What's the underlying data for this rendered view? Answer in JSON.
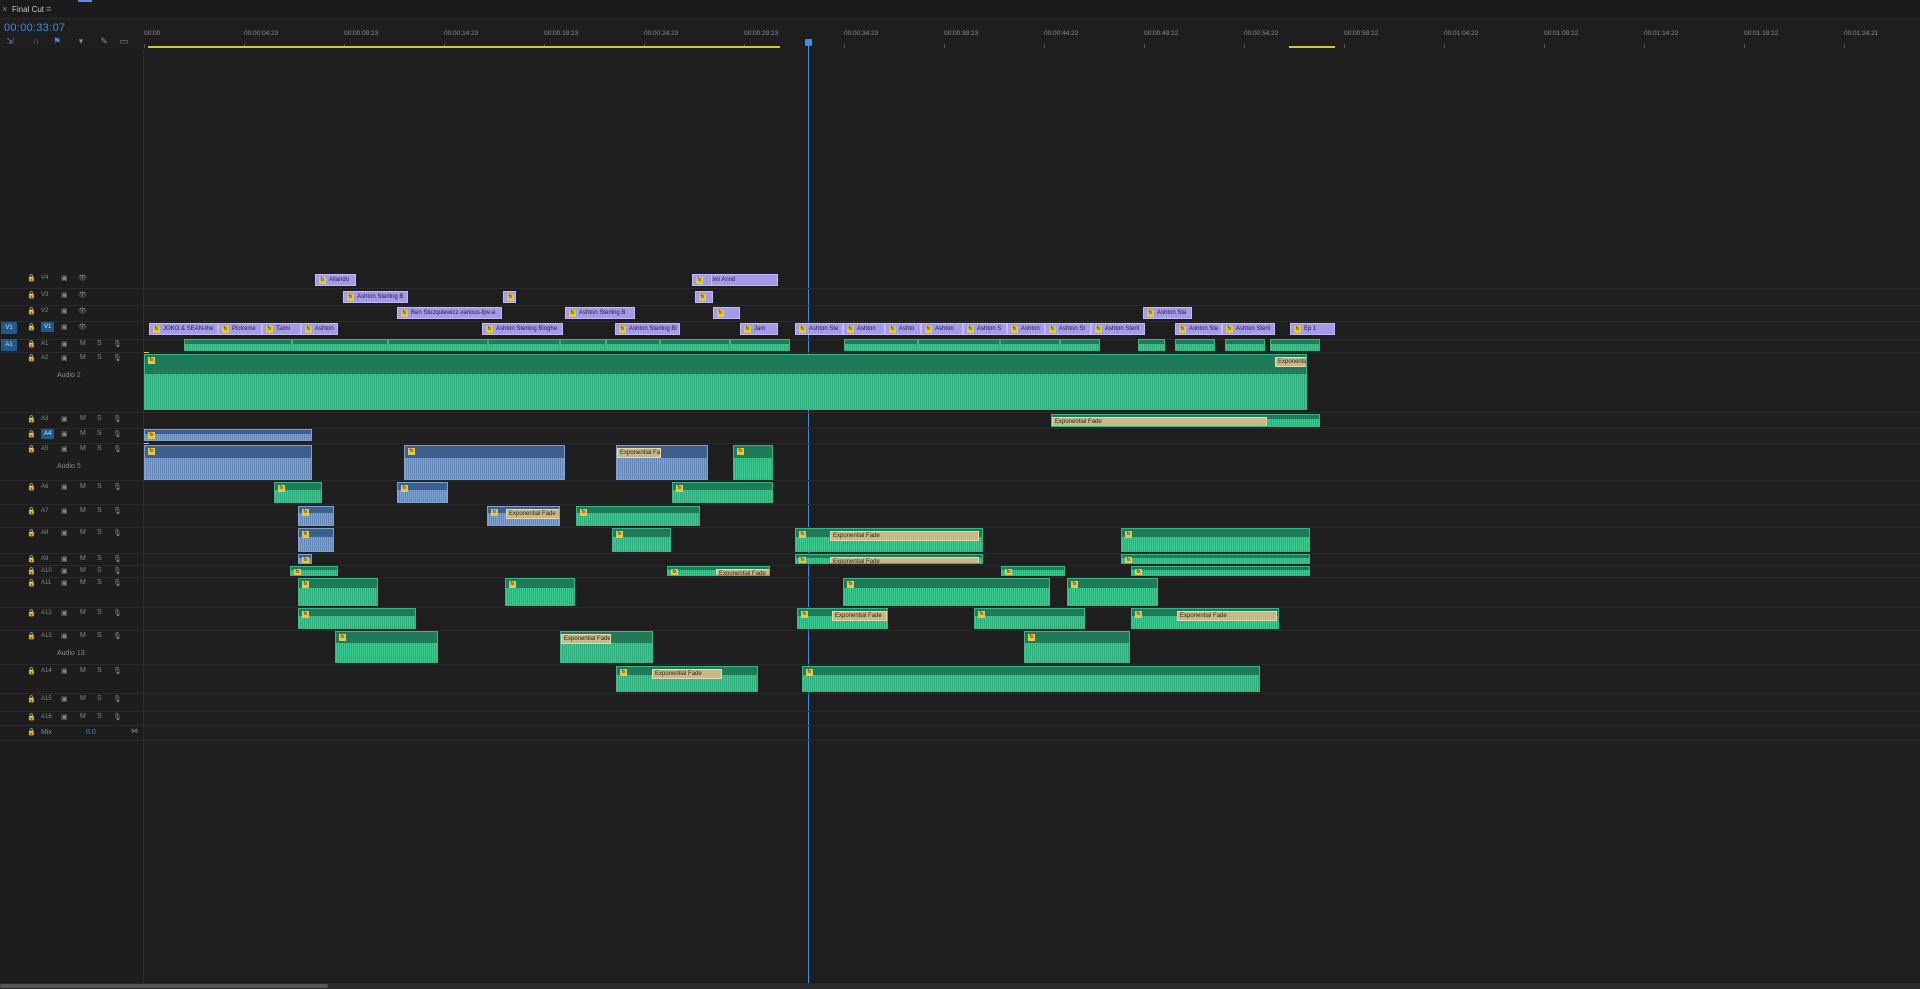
{
  "sequence": {
    "close_glyph": "×",
    "name": "Final Cut",
    "menu_glyph": "≡"
  },
  "timecode": "00:00:33:07",
  "tools": [
    "snap-icon",
    "linked-selection-icon",
    "add-marker-icon",
    "marker-icon",
    "wrench-icon",
    "captions-icon"
  ],
  "ruler": {
    "labels": [
      "00:00",
      "00:00:04:23",
      "00:00:09:23",
      "00:00:14:23",
      "00:00:19:23",
      "00:00:24:23",
      "00:00:29:23",
      "00:00:34:23",
      "00:00:39:23",
      "00:00:44:22",
      "00:00:49:22",
      "00:00:54:22",
      "00:00:59:22",
      "00:01:04:22",
      "00:01:09:22",
      "00:01:14:22",
      "00:01:19:22",
      "00:01:24:21"
    ]
  },
  "tracks": {
    "video": [
      {
        "id": "V4",
        "name": "V4"
      },
      {
        "id": "V3",
        "name": "V3"
      },
      {
        "id": "V2",
        "name": "V2"
      },
      {
        "id": "V1",
        "name": "V1",
        "source": "V1",
        "target": "V1"
      }
    ],
    "audio": [
      {
        "id": "A1",
        "name": "A1",
        "source": "A1"
      },
      {
        "id": "A2",
        "name": "A2",
        "label": "Audio 2"
      },
      {
        "id": "A3",
        "name": "A3"
      },
      {
        "id": "A4",
        "name": "A4",
        "target": "A4"
      },
      {
        "id": "A5",
        "name": "A5",
        "label": "Audio 5"
      },
      {
        "id": "A6",
        "name": "A6"
      },
      {
        "id": "A7",
        "name": "A7"
      },
      {
        "id": "A8",
        "name": "A8"
      },
      {
        "id": "A9",
        "name": "A9"
      },
      {
        "id": "A10",
        "name": "A10"
      },
      {
        "id": "A11",
        "name": "A11"
      },
      {
        "id": "A12",
        "name": "A12"
      },
      {
        "id": "A13",
        "name": "A13",
        "label": "Audio 13"
      },
      {
        "id": "A14",
        "name": "A14"
      },
      {
        "id": "A15",
        "name": "A15"
      },
      {
        "id": "A16",
        "name": "A16"
      }
    ],
    "mix": {
      "label": "Mix",
      "value": "0.0"
    },
    "controls": {
      "m": "M",
      "s": "S"
    }
  },
  "video_clips": {
    "v4": [
      "Allando",
      "Taimi Annd"
    ],
    "v3": [
      "Ashton Sterling B"
    ],
    "v2": [
      "Ben Stuzquiewicz-various-fpv-a",
      "Ashton Sterling B",
      "Ashton Ste"
    ],
    "v1": [
      "JOKO & SEAN-the",
      "Pictreme",
      "Taimi",
      "Ashton",
      "Ashton Sterling Binghe",
      "Ashton Sterling Bi",
      "Jam",
      "Ashton Ste",
      "Ashton",
      "Ashto",
      "Ashton",
      "Ashton S",
      "Ashton",
      "Ashton St",
      "Ashton Sterli",
      "Ashton Ste",
      "Ashton Sterli",
      "Ep 1"
    ]
  },
  "fades": [
    "Exponential",
    "Exponential Fade",
    "Exponential Fade",
    "Exponential Fade",
    "Exponential Fade",
    "Exponential Fade",
    "Exponential Fade",
    "Exponential Fade",
    "Exponential Fade",
    "Exponential Fade",
    "Exponential Fade"
  ]
}
